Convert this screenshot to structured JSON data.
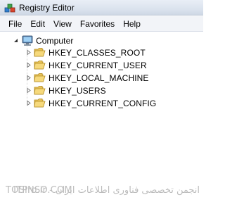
{
  "window": {
    "title": "Registry Editor",
    "icon": "registry-editor-icon"
  },
  "menu": [
    "File",
    "Edit",
    "View",
    "Favorites",
    "Help"
  ],
  "tree": {
    "root": {
      "label": "Computer",
      "icon": "computer-icon",
      "expanded": true
    },
    "keys": [
      {
        "label": "HKEY_CLASSES_ROOT",
        "icon": "folder-icon"
      },
      {
        "label": "HKEY_CURRENT_USER",
        "icon": "folder-icon"
      },
      {
        "label": "HKEY_LOCAL_MACHINE",
        "icon": "folder-icon"
      },
      {
        "label": "HKEY_USERS",
        "icon": "folder-icon"
      },
      {
        "label": "HKEY_CURRENT_CONFIG",
        "icon": "folder-icon"
      }
    ]
  },
  "watermark": {
    "left": "TOSINSO.COM",
    "right": "انجمن تخصصی فناوری اطلاعات ایران - ITPro.ir"
  },
  "colors": {
    "folder": "#e8c35a",
    "selection": "#cde8ff",
    "titlebar": "#dbe3ee"
  }
}
